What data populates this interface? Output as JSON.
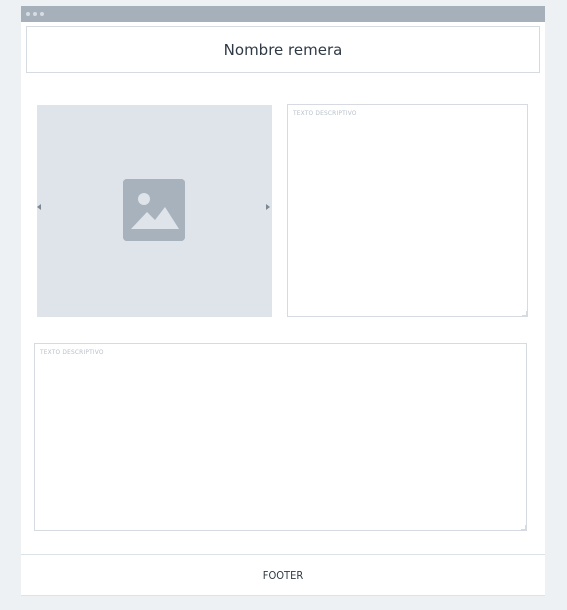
{
  "window": {
    "title": ""
  },
  "header": {
    "title": "Nombre remera"
  },
  "carousel": {
    "image_icon": "image-icon",
    "prev_icon": "arrow-left-icon",
    "next_icon": "arrow-right-icon"
  },
  "description_side": {
    "placeholder": "TEXTO DESCRIPTIVO",
    "value": ""
  },
  "description_bottom": {
    "placeholder": "TEXTO DESCRIPTIVO",
    "value": ""
  },
  "footer": {
    "label": "FOOTER"
  },
  "colors": {
    "titlebar": "#a6b0bb",
    "image_placeholder_bg": "#dfe4ea",
    "image_icon": "#a7b2bd",
    "border": "#d5dbe1",
    "text": "#2f3a45",
    "placeholder_text": "#b7c0c9"
  }
}
